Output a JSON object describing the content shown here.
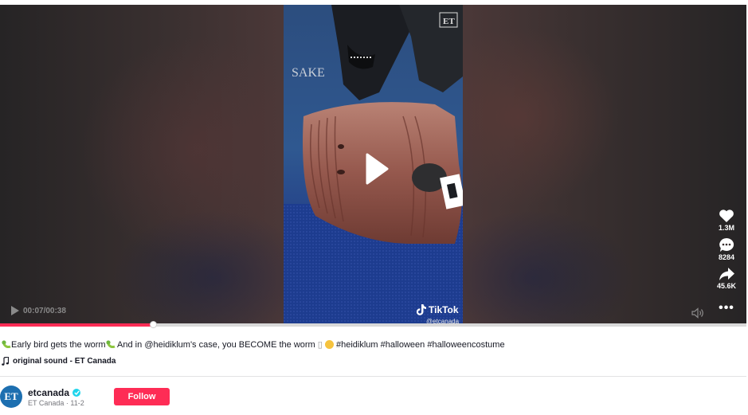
{
  "player": {
    "watermark": {
      "brand": "TikTok",
      "handle": "@etcanada"
    },
    "video_overlay": {
      "badge": "ET",
      "backdrop_text": "SAKE"
    },
    "time": {
      "current": "00:07",
      "total": "00:38",
      "display": "00:07/00:38"
    },
    "progress_fraction": 0.205,
    "actions": {
      "likes": "1.3M",
      "comments": "8284",
      "shares": "45.6K"
    }
  },
  "caption": {
    "part1": "Early bird gets the worm",
    "part2": " And in ",
    "mention": "@heidiklum",
    "part3": "'s case, you BECOME the worm ",
    "missing_glyph": "▯",
    "hashtags": [
      "#heidiklum",
      "#halloween",
      "#halloweencostume"
    ]
  },
  "sound": {
    "label": "original sound - ET Canada"
  },
  "author": {
    "avatar_text": "ET",
    "username": "etcanada",
    "subtitle": "ET Canada · 11-2",
    "follow_label": "Follow"
  },
  "colors": {
    "accent": "#fe2c55",
    "verified": "#20d5ec"
  },
  "icons": [
    "play-icon",
    "heart-icon",
    "comment-icon",
    "share-icon",
    "more-icon",
    "volume-icon",
    "music-note-icon",
    "verified-icon",
    "tiktok-logo-icon"
  ]
}
